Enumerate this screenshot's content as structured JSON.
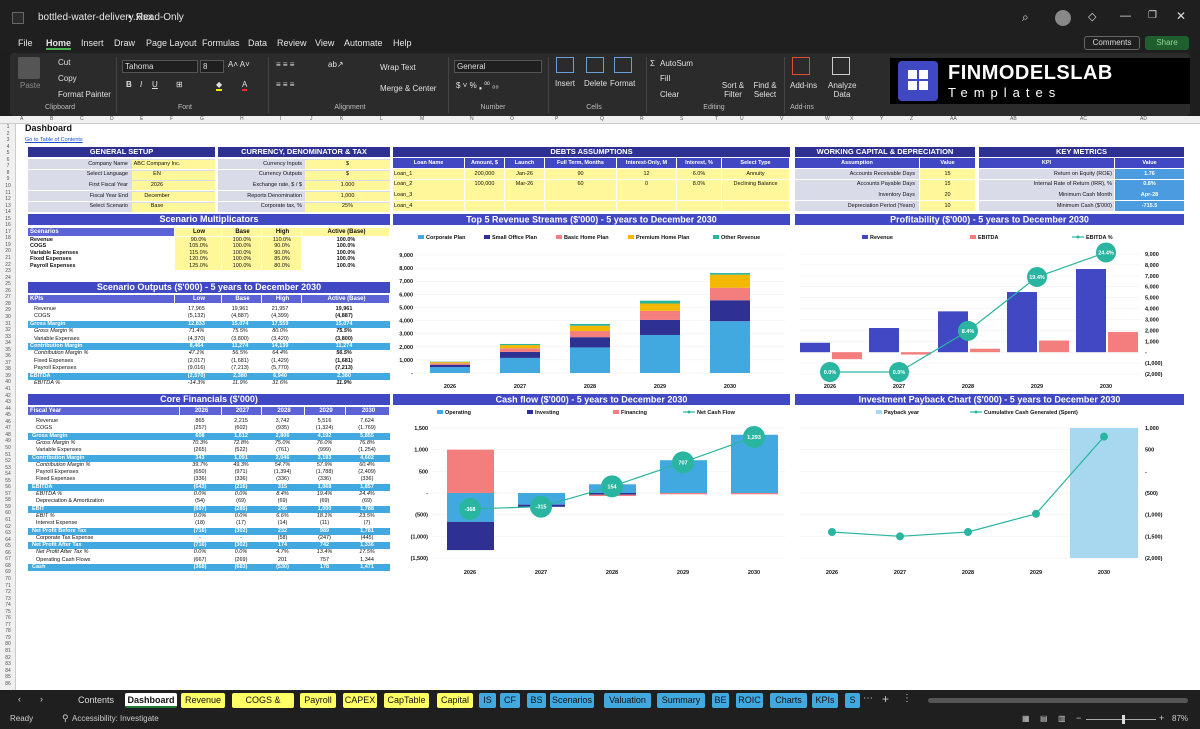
{
  "window": {
    "filename": "bottled-water-delivery.xlsx",
    "mode": "Read-Only"
  },
  "menu": [
    "File",
    "Home",
    "Insert",
    "Draw",
    "Page Layout",
    "Formulas",
    "Data",
    "Review",
    "View",
    "Automate",
    "Help"
  ],
  "menu_right": {
    "comments": "Comments",
    "share": "Share"
  },
  "ribbon": {
    "paste": "Paste",
    "cut": "Cut",
    "copy": "Copy",
    "format_painter": "Format Painter",
    "clipboard": "Clipboard",
    "font_name": "Tahoma",
    "font_size": "8",
    "font": "Font",
    "wrap": "Wrap Text",
    "merge": "Merge & Center",
    "alignment": "Alignment",
    "number_format": "General",
    "number": "Number",
    "insert": "Insert",
    "delete": "Delete",
    "format": "Format",
    "cells": "Cells",
    "autosum": "AutoSum",
    "fill": "Fill",
    "clear": "Clear",
    "sort": "Sort & Filter",
    "find": "Find & Select",
    "editing": "Editing",
    "addins": "Add-ins",
    "addins_group": "Add-ins",
    "analyze": "Analyze Data",
    "logo_main": "FINMODELSLAB",
    "logo_sub": "Templates"
  },
  "sheet": {
    "title": "Dashboard",
    "toc_link": "Go to Table of Contents",
    "columns": [
      "A",
      "B",
      "C",
      "D",
      "E",
      "F",
      "G",
      "H",
      "I",
      "J",
      "K",
      "L",
      "M",
      "N",
      "O",
      "P",
      "Q",
      "R",
      "S",
      "T",
      "U",
      "V",
      "W",
      "X",
      "Y",
      "Z",
      "AA",
      "AB",
      "AC",
      "AD"
    ],
    "general_setup": {
      "title": "GENERAL SETUP",
      "rows": [
        [
          "Company Name",
          "ABC Company Inc."
        ],
        [
          "Select Language",
          "EN"
        ],
        [
          "First Fiscal Year",
          "2026"
        ],
        [
          "Fiscal Year End",
          "December"
        ],
        [
          "Select Scenario",
          "Base"
        ]
      ]
    },
    "currency": {
      "title": "CURRENCY, DENOMINATOR & TAX",
      "rows": [
        [
          "Currency Inputs",
          "$"
        ],
        [
          "Currency Outputs",
          "$"
        ],
        [
          "Exchange rate, $ / $",
          "1.000"
        ],
        [
          "Reports Denomination",
          "1,000"
        ],
        [
          "Corporate tax, %",
          "25%"
        ]
      ]
    },
    "debts": {
      "title": "DEBTS ASSUMPTIONS",
      "headers": [
        "Loan Name",
        "Amount, $",
        "Launch",
        "Full Term, Months",
        "Interest-Only, M",
        "Interest, %",
        "Select Type"
      ],
      "rows": [
        [
          "Loan_1",
          "200,000",
          "Jan-26",
          "90",
          "12",
          "6.0%",
          "Annuity"
        ],
        [
          "Loan_2",
          "100,000",
          "Mar-26",
          "60",
          "0",
          "8.0%",
          "Declining Balance"
        ],
        [
          "Loan_3",
          "",
          "",
          "",
          "",
          "",
          ""
        ],
        [
          "Loan_4",
          "",
          "",
          "",
          "",
          "",
          ""
        ]
      ]
    },
    "working_capital": {
      "title": "WORKING CAPITAL & DEPRECIATION",
      "headers": [
        "Assumption",
        "Value"
      ],
      "rows": [
        [
          "Accounts Receivable Days",
          "15"
        ],
        [
          "Accounts Payable Days",
          "15"
        ],
        [
          "Inventory Days",
          "20"
        ],
        [
          "Depreciation Period (Years)",
          "10"
        ]
      ]
    },
    "key_metrics": {
      "title": "KEY METRICS",
      "headers": [
        "KPI",
        "Value"
      ],
      "rows": [
        [
          "Return on Equity (ROE)",
          "1.76"
        ],
        [
          "Internal Rate of Return (IRR), %",
          "0.8%"
        ],
        [
          "Minimum Cash Month",
          "Apr-28"
        ],
        [
          "Minimum Cash ($'000)",
          "-715.5"
        ]
      ]
    },
    "scenario_mult": {
      "title": "Scenario Multiplicators",
      "headers": [
        "Scenarios",
        "Low",
        "Base",
        "High",
        "Active (Base)"
      ],
      "rows": [
        [
          "Revenue",
          "90.0%",
          "100.0%",
          "110.0%",
          "100.0%"
        ],
        [
          "COGS",
          "105.0%",
          "100.0%",
          "90.0%",
          "100.0%"
        ],
        [
          "Variable Expenses",
          "115.0%",
          "100.0%",
          "90.0%",
          "100.0%"
        ],
        [
          "Fixed Expenses",
          "120.0%",
          "100.0%",
          "85.0%",
          "100.0%"
        ],
        [
          "Payroll Expenses",
          "125.0%",
          "100.0%",
          "80.0%",
          "100.0%"
        ]
      ]
    },
    "scenario_out": {
      "title": "Scenario Outputs ($'000) - 5 years to December 2030",
      "headers": [
        "KPIs",
        "Low",
        "Base",
        "High",
        "Active (Base)"
      ],
      "rows": [
        [
          "Revenue",
          "17,965",
          "19,961",
          "21,957",
          "19,961"
        ],
        [
          "COGS",
          "(5,132)",
          "(4,887)",
          "(4,399)",
          "(4,887)"
        ],
        [
          "Gross Margin",
          "12,833",
          "15,074",
          "17,559",
          "15,074"
        ],
        [
          "Gross Margin %",
          "71.4%",
          "75.5%",
          "80.0%",
          "75.5%"
        ],
        [
          "Variable Expenses",
          "(4,370)",
          "(3,800)",
          "(3,420)",
          "(3,800)"
        ],
        [
          "Contribution Margin",
          "8,464",
          "11,274",
          "14,139",
          "11,274"
        ],
        [
          "Contribution Margin %",
          "47.1%",
          "56.5%",
          "64.4%",
          "56.5%"
        ],
        [
          "Fixed Expenses",
          "(2,017)",
          "(1,681)",
          "(1,429)",
          "(1,681)"
        ],
        [
          "Payroll Expenses",
          "(9,016)",
          "(7,213)",
          "(5,770)",
          "(7,213)"
        ],
        [
          "EBITDA",
          "(2,570)",
          "2,380",
          "6,940",
          "2,380"
        ],
        [
          "EBITDA %",
          "-14.3%",
          "11.9%",
          "31.6%",
          "11.9%"
        ]
      ]
    },
    "core": {
      "title": "Core Financials ($'000)",
      "headers": [
        "Fiscal Year",
        "2026",
        "2027",
        "2028",
        "2029",
        "2030"
      ],
      "rows": [
        [
          "Revenue",
          "865",
          "2,215",
          "3,742",
          "5,516",
          "7,624"
        ],
        [
          "COGS",
          "(257)",
          "(602)",
          "(935)",
          "(1,324)",
          "(1,769)"
        ],
        [
          "Gross Margin",
          "608",
          "1,612",
          "2,806",
          "4,192",
          "5,855"
        ],
        [
          "Gross Margin %",
          "70.3%",
          "72.8%",
          "75.0%",
          "76.0%",
          "76.8%"
        ],
        [
          "Variable Expenses",
          "(265)",
          "(522)",
          "(761)",
          "(999)",
          "(1,254)"
        ],
        [
          "Contribution Margin",
          "343",
          "1,091",
          "2,046",
          "3,193",
          "4,602"
        ],
        [
          "Contribution Margin %",
          "39.7%",
          "49.3%",
          "54.7%",
          "57.9%",
          "60.4%"
        ],
        [
          "Payroll Expenses",
          "(650)",
          "(971)",
          "(1,394)",
          "(1,788)",
          "(2,409)"
        ],
        [
          "Fixed Expenses",
          "(336)",
          "(336)",
          "(336)",
          "(336)",
          "(336)"
        ],
        [
          "EBITDA",
          "(643)",
          "(216)",
          "315",
          "1,068",
          "1,857"
        ],
        [
          "EBITDA %",
          "0.0%",
          "0.0%",
          "8.4%",
          "19.4%",
          "24.4%"
        ],
        [
          "Depreciation & Amortization",
          "(54)",
          "(69)",
          "(69)",
          "(69)",
          "(69)"
        ],
        [
          "EBIT",
          "(697)",
          "(285)",
          "246",
          "1,000",
          "1,788"
        ],
        [
          "EBIT %",
          "0.0%",
          "0.0%",
          "6.6%",
          "18.1%",
          "23.5%"
        ],
        [
          "Interest Expense",
          "(18)",
          "(17)",
          "(14)",
          "(11)",
          "(7)"
        ],
        [
          "Net Profit Before Tax",
          "(716)",
          "(302)",
          "232",
          "989",
          "1,781"
        ],
        [
          "Corporate Tax Expense",
          "-",
          "-",
          "(58)",
          "(247)",
          "(445)"
        ],
        [
          "Net Profit After Tax",
          "(716)",
          "(302)",
          "174",
          "742",
          "1,336"
        ],
        [
          "Net Profit After Tax %",
          "0.0%",
          "0.0%",
          "4.7%",
          "13.4%",
          "17.5%"
        ],
        [
          "Operating Cash Flows",
          "(667)",
          "(269)",
          "201",
          "757",
          "1,344"
        ],
        [
          "Cash",
          "(368)",
          "(683)",
          "(530)",
          "178",
          "1,471"
        ]
      ]
    }
  },
  "chart_data": [
    {
      "type": "bar",
      "title": "Top 5 Revenue Streams ($'000) - 5 years to December 2030",
      "categories": [
        "2026",
        "2027",
        "2028",
        "2029",
        "2030"
      ],
      "ylim": [
        0,
        9000
      ],
      "yticks": [
        "-",
        "1,000",
        "2,000",
        "3,000",
        "4,000",
        "5,000",
        "6,000",
        "7,000",
        "8,000",
        "9,000"
      ],
      "series": [
        {
          "name": "Corporate Plan",
          "color": "#42a8e0",
          "values": [
            450,
            1150,
            1950,
            2900,
            3950
          ]
        },
        {
          "name": "Small Office Plan",
          "color": "#2e3192",
          "values": [
            180,
            460,
            780,
            1150,
            1600
          ]
        },
        {
          "name": "Basic Home Plan",
          "color": "#f47e7e",
          "values": [
            110,
            280,
            470,
            690,
            950
          ]
        },
        {
          "name": "Premium Home Plan",
          "color": "#f5b800",
          "values": [
            90,
            240,
            400,
            560,
            1000
          ]
        },
        {
          "name": "Other Revenue",
          "color": "#2ab5a0",
          "values": [
            35,
            85,
            142,
            216,
            124
          ]
        }
      ]
    },
    {
      "type": "bar",
      "title": "Profitability ($'000) - 5 years to December 2030",
      "categories": [
        "2026",
        "2027",
        "2028",
        "2029",
        "2030"
      ],
      "ylim": [
        -2000,
        9000
      ],
      "yticks_right": [
        "9,000",
        "8,000",
        "7,000",
        "6,000",
        "5,000",
        "4,000",
        "3,000",
        "2,000",
        "1,000",
        "-",
        "(1,000)",
        "(2,000)"
      ],
      "series": [
        {
          "name": "Revenue",
          "color": "#4148c4",
          "values": [
            865,
            2215,
            3742,
            5516,
            7624
          ]
        },
        {
          "name": "EBITDA",
          "color": "#f47e7e",
          "values": [
            -643,
            -216,
            315,
            1068,
            1857
          ]
        },
        {
          "name": "EBITDA %",
          "color": "#2ab5a0",
          "values": [
            0.0,
            0.0,
            8.4,
            19.4,
            24.4
          ],
          "labels": [
            "0.0%",
            "0.0%",
            "8.4%",
            "19.4%",
            "24.4%"
          ]
        }
      ]
    },
    {
      "type": "bar",
      "title": "Cash flow ($'000) - 5 years to December 2030",
      "categories": [
        "2026",
        "2027",
        "2028",
        "2029",
        "2030"
      ],
      "ylim": [
        -1500,
        1500
      ],
      "yticks": [
        "1,500",
        "1,000",
        "500",
        "-",
        "(500)",
        "(1,000)",
        "(1,500)"
      ],
      "series": [
        {
          "name": "Operating",
          "color": "#42a8e0",
          "values": [
            -667,
            -269,
            201,
            757,
            1344
          ]
        },
        {
          "name": "Investing",
          "color": "#2e3192",
          "values": [
            -650,
            -50,
            -40,
            0,
            0
          ]
        },
        {
          "name": "Financing",
          "color": "#f47e7e",
          "values": [
            1000,
            0,
            -30,
            -30,
            -30
          ]
        },
        {
          "name": "Net Cash Flow",
          "color": "#2ab5a0",
          "values": [
            -368,
            -315,
            154,
            707,
            1293
          ],
          "labels": [
            "-368",
            "-315",
            "154",
            "707",
            "1,293"
          ]
        }
      ]
    },
    {
      "type": "line",
      "title": "Investment Payback Chart ($'000) - 5 years to December 2030",
      "categories": [
        "2026",
        "2027",
        "2028",
        "2029",
        "2030"
      ],
      "ylim": [
        -2000,
        1000
      ],
      "yticks_right": [
        "1,000",
        "500",
        "-",
        "(500)",
        "(1,000)",
        "(1,500)",
        "(2,000)"
      ],
      "series": [
        {
          "name": "Payback year",
          "color": "#a8d8f0",
          "values": [
            0,
            0,
            0,
            0,
            1
          ]
        },
        {
          "name": "Cumulative Cash Generated (Spent)",
          "color": "#2ab5a0",
          "values": [
            -1400,
            -1500,
            -1400,
            -980,
            800
          ]
        }
      ]
    }
  ],
  "tabs": [
    {
      "label": "Contents",
      "color": "#1f1f1f",
      "text": "#ddd"
    },
    {
      "label": "Dashboard",
      "color": "#ffffff",
      "text": "#111",
      "active": true
    },
    {
      "label": "Revenue",
      "color": "#ffff66"
    },
    {
      "label": "COGS & OPEX",
      "color": "#ffff66"
    },
    {
      "label": "Payroll",
      "color": "#ffff66"
    },
    {
      "label": "CAPEX",
      "color": "#ffff66"
    },
    {
      "label": "CapTable",
      "color": "#ffff66"
    },
    {
      "label": "Capital",
      "color": "#ffff66"
    },
    {
      "label": "IS",
      "color": "#42a8e0"
    },
    {
      "label": "CF",
      "color": "#42a8e0"
    },
    {
      "label": "BS",
      "color": "#42a8e0"
    },
    {
      "label": "Scenarios",
      "color": "#42a8e0"
    },
    {
      "label": "Valuation",
      "color": "#42a8e0"
    },
    {
      "label": "Summary",
      "color": "#42a8e0"
    },
    {
      "label": "BE",
      "color": "#42a8e0"
    },
    {
      "label": "ROIC",
      "color": "#42a8e0"
    },
    {
      "label": "Charts",
      "color": "#42a8e0"
    },
    {
      "label": "KPIs",
      "color": "#42a8e0"
    },
    {
      "label": "S",
      "color": "#42a8e0"
    }
  ],
  "status": {
    "ready": "Ready",
    "accessibility": "Accessibility: Investigate",
    "zoom": "87%"
  }
}
